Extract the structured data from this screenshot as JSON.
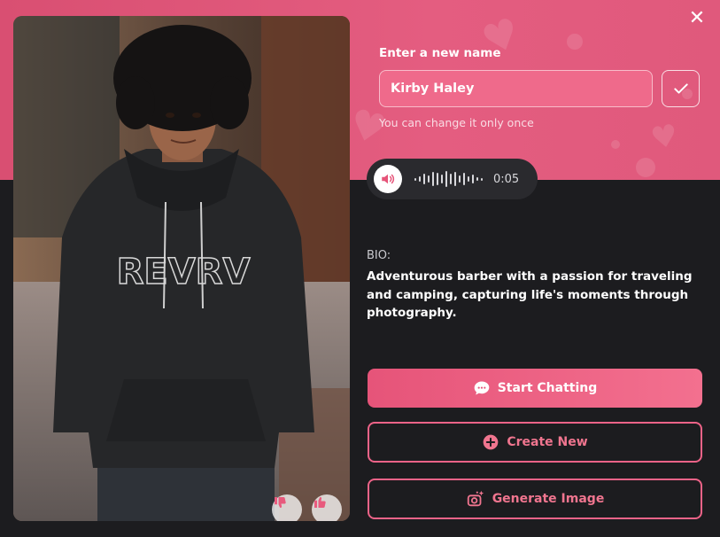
{
  "header": {
    "close_icon": "close-icon"
  },
  "name_editor": {
    "label": "Enter a new name",
    "value": "Kirby Haley",
    "hint": "You can change it only once",
    "confirm_icon": "checkmark-icon"
  },
  "voice_preview": {
    "icon": "speaker-icon",
    "duration": "0:05"
  },
  "photo": {
    "shirt_text": "REVRV",
    "dislike_icon": "thumbs-down-icon",
    "like_icon": "thumbs-up-icon"
  },
  "bio": {
    "label": "BIO:",
    "text": "Adventurous barber with a passion for traveling and camping, capturing life's moments through photography."
  },
  "actions": {
    "start_chatting": "Start Chatting",
    "create_new": "Create New",
    "generate_image": "Generate Image"
  },
  "colors": {
    "accent": "#e65479",
    "header_pink": "#e05a7e",
    "background": "#1c1c1f",
    "outline": "#ee6388"
  }
}
